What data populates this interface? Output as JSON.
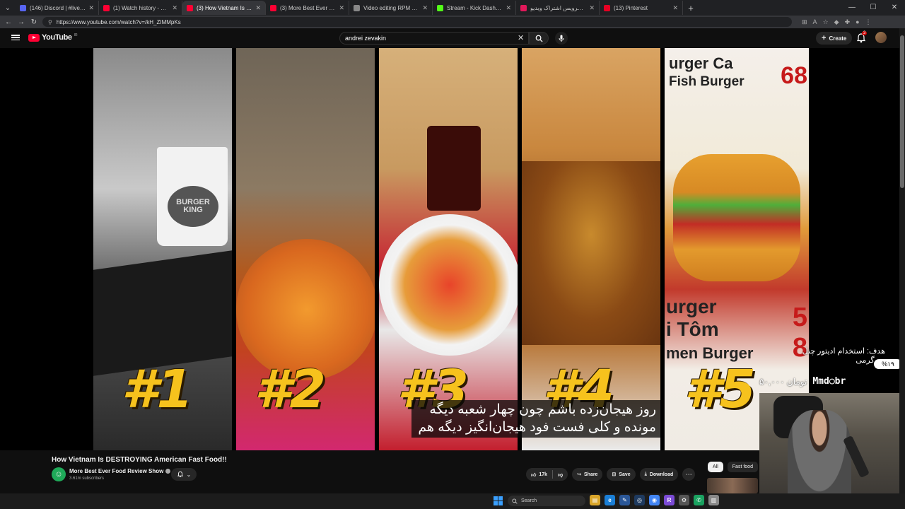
{
  "browser": {
    "tabs": [
      {
        "title": "(146) Discord | #live-shodam | br",
        "color": "#5865f2",
        "active": false
      },
      {
        "title": "(1) Watch history - YouTube",
        "color": "#ff0033",
        "active": false
      },
      {
        "title": "(3) How Vietnam Is DESTROYING",
        "color": "#ff0033",
        "active": true
      },
      {
        "title": "(3) More Best Ever Food Review",
        "color": "#ff0033",
        "active": false
      },
      {
        "title": "Video editing RPM estimate",
        "color": "#888888",
        "active": false
      },
      {
        "title": "Stream - Kick Dashboard",
        "color": "#53fc18",
        "active": false
      },
      {
        "title": "آپارات - سرویس اشتراک ویدیو",
        "color": "#e0185a",
        "active": false
      },
      {
        "title": "(13) Pinterest",
        "color": "#e60023",
        "active": false
      }
    ],
    "url": "https://www.youtube.com/watch?v=/kH_ZIMMpKs"
  },
  "masthead": {
    "logo_text": "YouTube",
    "region": "IR",
    "search_value": "andrei zevakin",
    "create_label": "Create",
    "notification_count": "3"
  },
  "video": {
    "title": "How Vietnam Is DESTROYING American Fast Food!!",
    "channel": "More Best Ever Food Review Show",
    "subscribers": "3.61m subscribers",
    "ranks": [
      "#1",
      "#2",
      "#3",
      "#4",
      "#5"
    ],
    "panel1_logo": "BURGER KING",
    "panel5_sign_top": "urger Ca",
    "panel5_sign_sub": "Fish Burger",
    "panel5_price_top": "68",
    "panel5_sign_low": "urger",
    "panel5_sign_low2": "i Tôm",
    "panel5_sign_low3": "men Burger",
    "panel5_price_low": "5",
    "panel5_price_low2": "8",
    "subtitle_line1": "روز هیجان‌زده باشم چون چهار شعبه دیگه",
    "subtitle_line2": "مونده و کلی فست فود هیجان‌انگیز دیگه هم"
  },
  "actions": {
    "likes": "17k",
    "share": "Share",
    "save": "Save",
    "download": "Download"
  },
  "chips": [
    "All",
    "Fast food"
  ],
  "stream_overlay": {
    "goal_text": "هدف: استخدام ادیتور چنل سرگرمی",
    "goal_percent": "%۱۹",
    "donor_amount": "۵۰,۰۰۰ تومان",
    "donor_name": "Mmd○br"
  },
  "taskbar": {
    "search_placeholder": "Search"
  }
}
